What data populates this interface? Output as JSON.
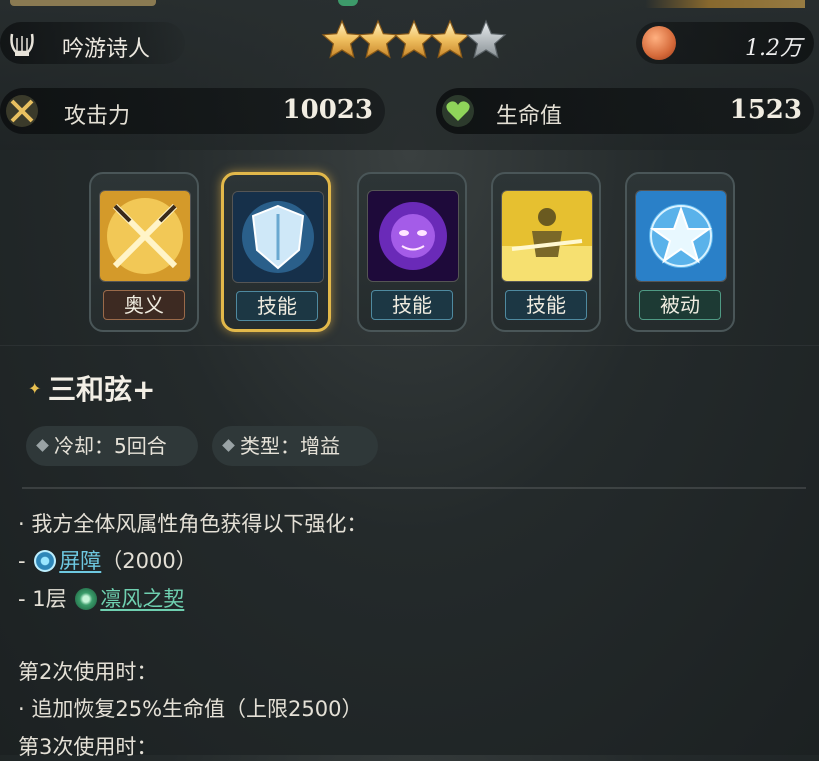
{
  "character": {
    "role_name": "吟游诗人",
    "stars_filled": 4,
    "stars_total": 5,
    "power_value": "1.2万"
  },
  "stats": {
    "attack_label": "攻击力",
    "attack_value": "10023",
    "hp_label": "生命值",
    "hp_value": "1523"
  },
  "skills": [
    {
      "tag": "奥义",
      "kind": "ultimate",
      "icon": "crossed-swords-icon"
    },
    {
      "tag": "技能",
      "kind": "skill",
      "icon": "shield-icon",
      "selected": true
    },
    {
      "tag": "技能",
      "kind": "skill",
      "icon": "purple-spirit-icon"
    },
    {
      "tag": "技能",
      "kind": "skill",
      "icon": "golden-knight-icon"
    },
    {
      "tag": "被动",
      "kind": "passive",
      "icon": "blue-star-icon"
    }
  ],
  "detail": {
    "title": "三和弦+",
    "cooldown": "冷却：5回合",
    "type": "类型：增益",
    "line1": "· 我方全体风属性角色获得以下强化：",
    "line2_prefix": "- ",
    "line2_link": "屏障",
    "line2_suffix": "（2000）",
    "line3_prefix": "- 1层 ",
    "line3_link": "凛风之契",
    "line4": "第2次使用时：",
    "line5": "· 追加恢复25%生命值（上限2500）",
    "line6": "第3次使用时："
  },
  "colors": {
    "accent_gold": "#e2b84a",
    "link_blue": "#6ec8e0",
    "link_green": "#6fd0b0"
  }
}
